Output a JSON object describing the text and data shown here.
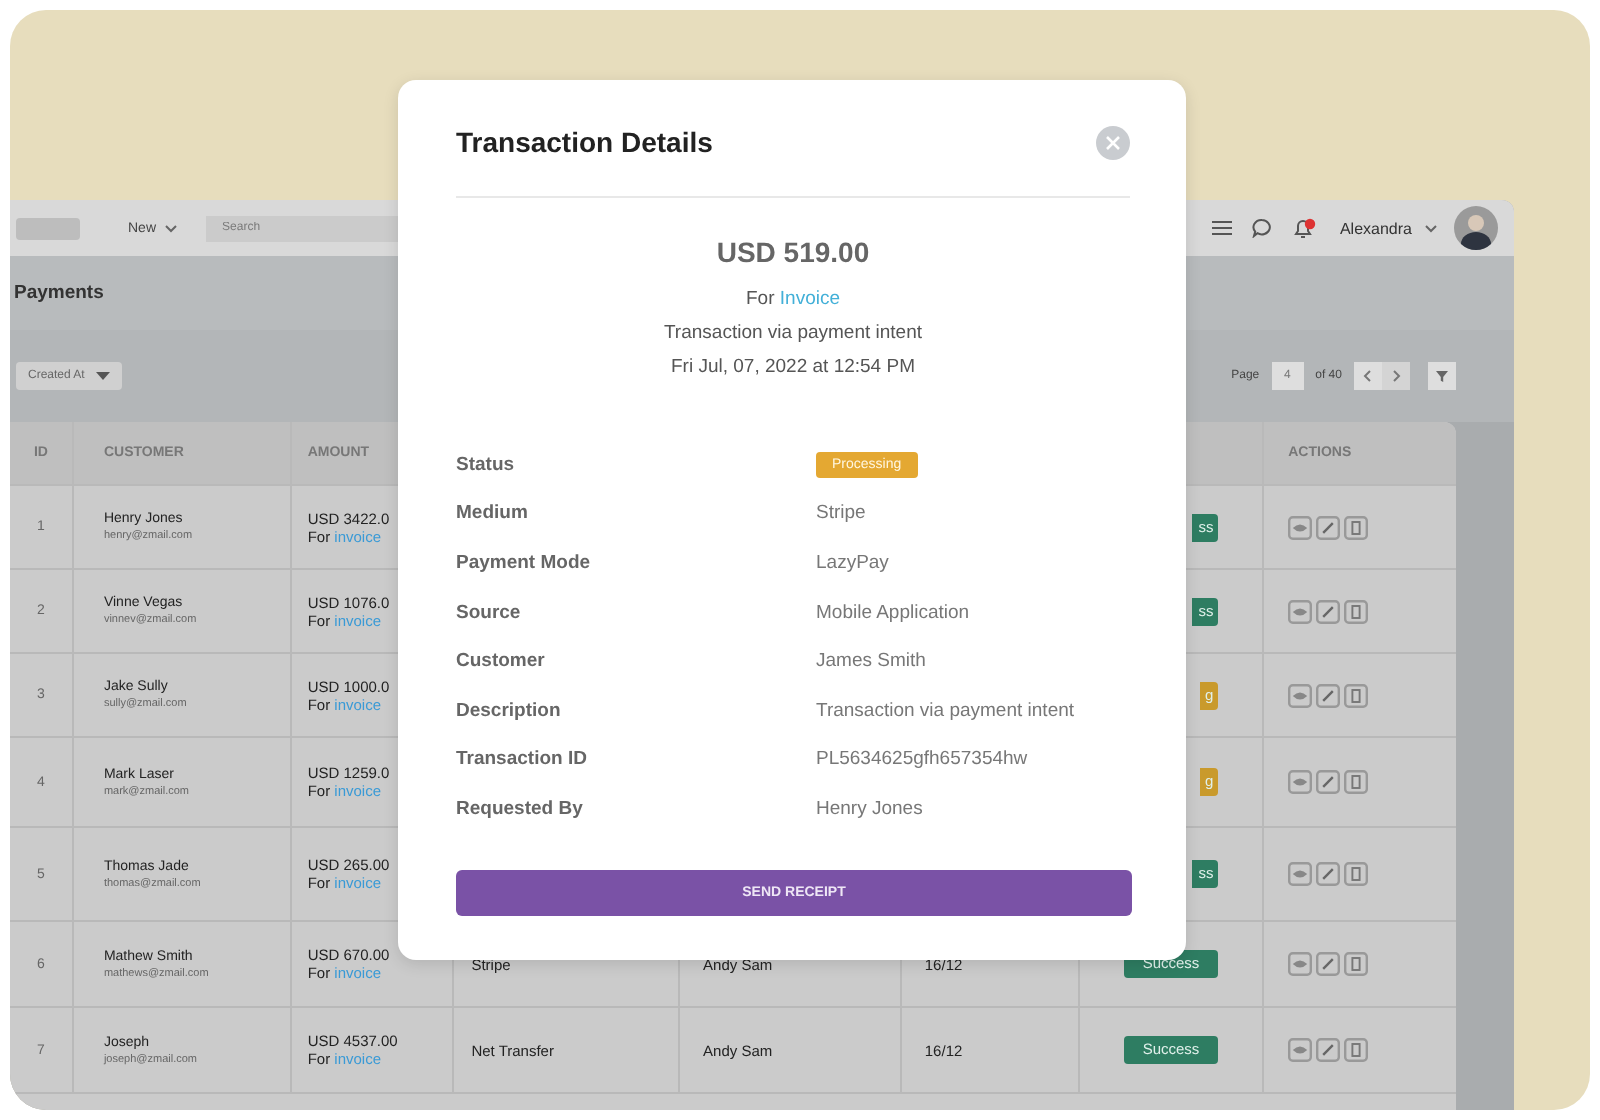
{
  "topbar": {
    "new_menu": "New",
    "search": {
      "placeholder": "Search"
    },
    "user": "Alexandra"
  },
  "page_title": "Payments",
  "filter": {
    "label": "Created At"
  },
  "pagination": {
    "label": "Page",
    "current": "4",
    "total": "of 40"
  },
  "table": {
    "columns": [
      "ID",
      "CUSTOMER",
      "AMOUNT",
      "ACTIONS"
    ],
    "rows": [
      {
        "id": "1",
        "name": "Henry Jones",
        "email": "henry@zmail.com",
        "amount": "USD 3422.0",
        "for_label": "For",
        "link": "invoice",
        "status": {
          "kind": "success",
          "text": "ss",
          "cut": true
        }
      },
      {
        "id": "2",
        "name": "Vinne Vegas",
        "email": "vinnev@zmail.com",
        "amount": "USD 1076.0",
        "for_label": "For",
        "link": "invoice",
        "status": {
          "kind": "success",
          "text": "ss",
          "cut": true
        }
      },
      {
        "id": "3",
        "name": "Jake Sully",
        "email": "sully@zmail.com",
        "amount": "USD 1000.0",
        "for_label": "For",
        "link": "invoice",
        "status": {
          "kind": "processing",
          "text": "g",
          "cut": true
        }
      },
      {
        "id": "4",
        "name": "Mark Laser",
        "email": "mark@zmail.com",
        "amount": "USD 1259.0",
        "for_label": "For",
        "link": "invoice",
        "status": {
          "kind": "processing",
          "text": "g",
          "cut": true
        }
      },
      {
        "id": "5",
        "name": "Thomas Jade",
        "email": "thomas@zmail.com",
        "amount": "USD 265.00",
        "for_label": "For",
        "link": "invoice",
        "status": {
          "kind": "success",
          "text": "ss",
          "cut": true
        }
      },
      {
        "id": "6",
        "name": "Mathew Smith",
        "email": "mathews@zmail.com",
        "amount": "USD 670.00",
        "for_label": "For",
        "link": "invoice",
        "medium": "Stripe",
        "customer": "Andy Sam",
        "date": "16/12",
        "status": {
          "kind": "success",
          "text": "Success",
          "cut": false
        }
      },
      {
        "id": "7",
        "name": "Joseph",
        "email": "joseph@zmail.com",
        "amount": "USD 4537.00",
        "for_label": "For",
        "link": "invoice",
        "medium": "Net Transfer",
        "customer": "Andy Sam",
        "date": "16/12",
        "status": {
          "kind": "success",
          "text": "Success",
          "cut": false
        }
      }
    ]
  },
  "modal": {
    "title": "Transaction Details",
    "amount": "USD 519.00",
    "for_label": "For",
    "link": "Invoice",
    "subtitle": "Transaction via payment intent",
    "date": "Fri Jul, 07, 2022 at 12:54 PM",
    "details": [
      {
        "label": "Status",
        "value": "Processing",
        "kind": "badge"
      },
      {
        "label": "Medium",
        "value": "Stripe",
        "kind": "text"
      },
      {
        "label": "Payment Mode",
        "value": "LazyPay",
        "kind": "text"
      },
      {
        "label": "Source",
        "value": "Mobile Application",
        "kind": "text"
      },
      {
        "label": "Customer",
        "value": "James Smith",
        "kind": "text"
      },
      {
        "label": "Description",
        "value": "Transaction via payment intent",
        "kind": "text"
      },
      {
        "label": "Transaction ID",
        "value": "PL5634625gfh657354hw",
        "kind": "text"
      },
      {
        "label": "Requested By",
        "value": "Henry Jones",
        "kind": "text"
      }
    ],
    "button": "SEND RECEIPT"
  }
}
